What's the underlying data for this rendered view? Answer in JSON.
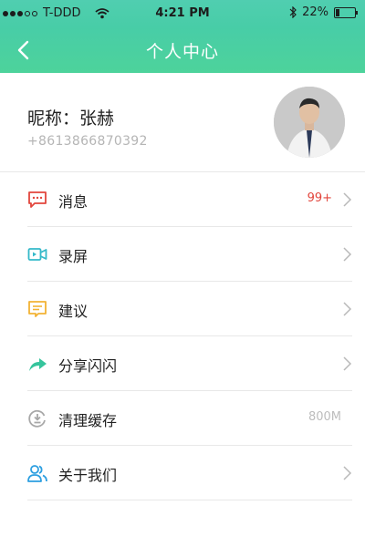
{
  "status_bar": {
    "carrier": "T-DDD",
    "time": "4:21 PM",
    "battery": "22%",
    "battery_level": 0.22
  },
  "nav": {
    "title": "个人中心",
    "back_icon": "chevron-left-icon"
  },
  "profile": {
    "nickname": "昵称：张赫",
    "phone": "+8613866870392",
    "avatar": "avatar"
  },
  "menu": [
    {
      "label": "消息",
      "icon": "message-icon",
      "value": "99+",
      "chevron": true,
      "color": "#e2453c"
    },
    {
      "label": "录屏",
      "icon": "video-icon",
      "value": "",
      "chevron": true,
      "color": "#34b9c9"
    },
    {
      "label": "建议",
      "icon": "feedback-icon",
      "value": "",
      "chevron": true,
      "color": "#f2b234"
    },
    {
      "label": "分享闪闪",
      "icon": "share-icon",
      "value": "",
      "chevron": true,
      "color": "#36c49c"
    },
    {
      "label": "清理缓存",
      "icon": "clear-cache-icon",
      "value": "800M",
      "chevron": false,
      "color": "#a8a8a8"
    },
    {
      "label": "关于我们",
      "icon": "about-us-icon",
      "value": "",
      "chevron": true,
      "color": "#2d9fe0"
    }
  ]
}
